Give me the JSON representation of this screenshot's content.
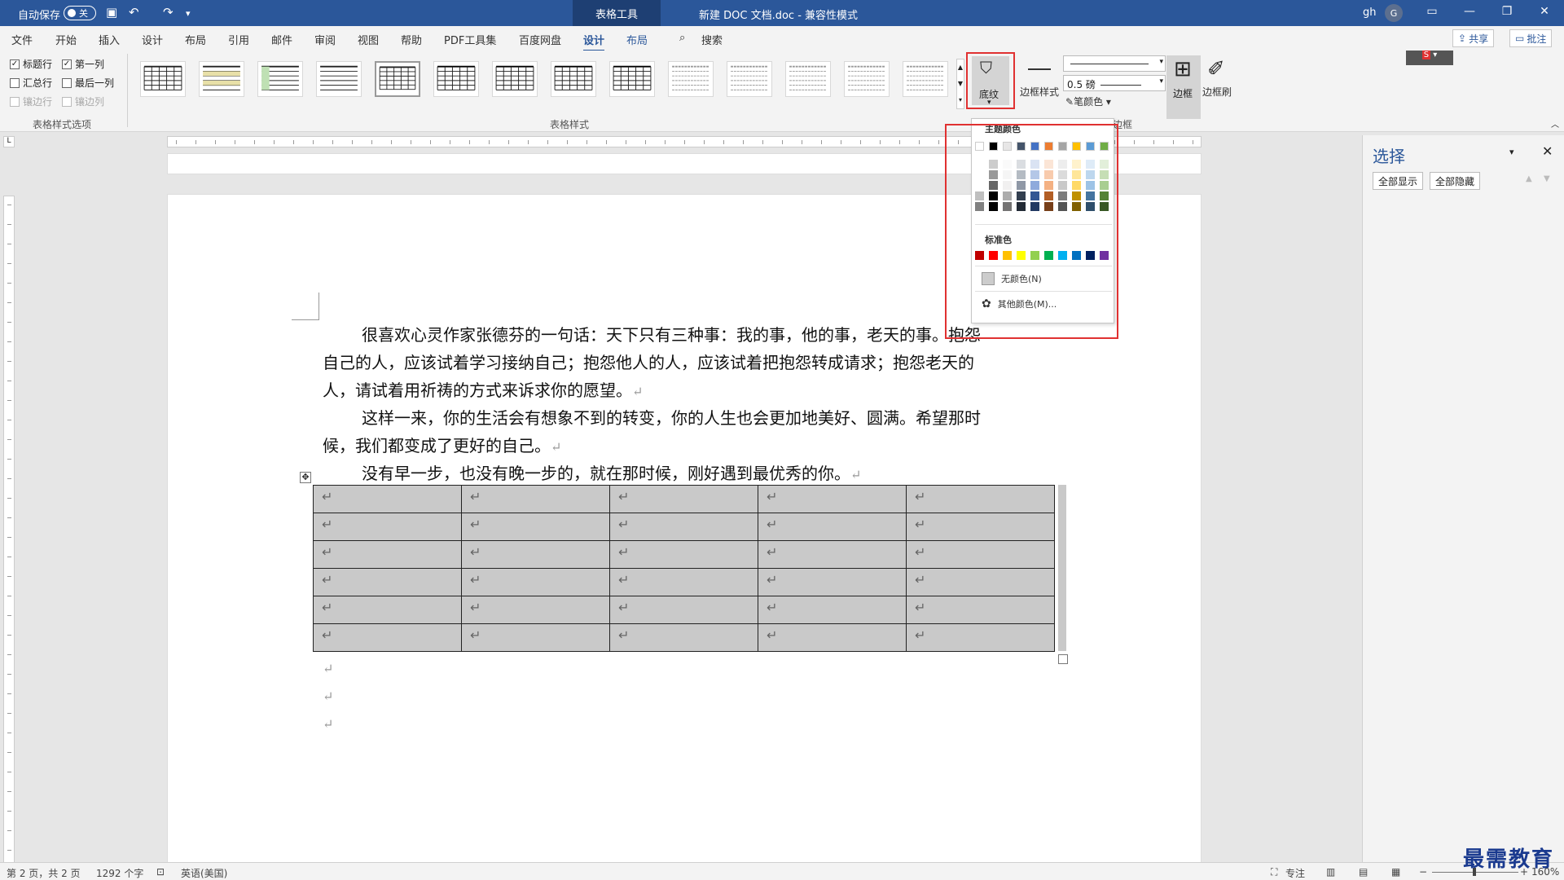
{
  "titlebar": {
    "autosave": "自动保存",
    "autosave_state": "关",
    "context_tab": "表格工具",
    "doc_title": "新建 DOC 文档.doc  -  兼容性模式",
    "user": "gh",
    "avatar": "G"
  },
  "menu": {
    "items": [
      "文件",
      "开始",
      "插入",
      "设计",
      "布局",
      "引用",
      "邮件",
      "审阅",
      "视图",
      "帮助",
      "PDF工具集",
      "百度网盘",
      "设计",
      "布局",
      "搜索"
    ],
    "share": "共享",
    "comment": "批注"
  },
  "ribbon": {
    "options": {
      "header_row": "标题行",
      "first_col": "第一列",
      "total_row": "汇总行",
      "last_col": "最后一列",
      "banded_rows": "镶边行",
      "banded_cols": "镶边列"
    },
    "group_options": "表格样式选项",
    "group_styles": "表格样式",
    "shading": "底纹",
    "border_styles": "边框样式",
    "pen_weight": "0.5 磅",
    "pen_color": "笔颜色",
    "borders": "边框",
    "border_painter": "边框刷",
    "group_border": "边框"
  },
  "dropdown": {
    "theme_colors": "主题颜色",
    "standard_colors": "标准色",
    "no_color": "无颜色(N)",
    "more_colors": "其他颜色(M)...",
    "theme_top": [
      "#ffffff",
      "#000000",
      "#e7e6e6",
      "#44546a",
      "#4472c4",
      "#ed7d31",
      "#a5a5a5",
      "#ffc000",
      "#5b9bd5",
      "#70ad47"
    ],
    "standard": [
      "#c00000",
      "#ff0000",
      "#ffc000",
      "#ffff00",
      "#92d050",
      "#00b050",
      "#00b0f0",
      "#0070c0",
      "#002060",
      "#7030a0"
    ]
  },
  "document": {
    "paragraphs": [
      "很喜欢心灵作家张德芬的一句话：天下只有三种事：我的事，他的事，老天的事。抱怨",
      "自己的人，应该试着学习接纳自己；抱怨他人的人，应该试着把抱怨转成请求；抱怨老天的",
      "人，请试着用祈祷的方式来诉求你的愿望。",
      "这样一来，你的生活会有想象不到的转变，你的人生也会更加地美好、圆满。希望那时",
      "候，我们都变成了更好的自己。",
      "没有早一步，也没有晚一步的，就在那时候，刚好遇到最优秀的你。"
    ],
    "cell_mark": "↵"
  },
  "pane": {
    "title": "选择",
    "show_all": "全部显示",
    "hide_all": "全部隐藏"
  },
  "statusbar": {
    "page": "第 2 页，共 2 页",
    "words": "1292 个字",
    "language": "英语(美国)",
    "focus": "专注",
    "zoom": "160%"
  },
  "watermark": "最需教育"
}
